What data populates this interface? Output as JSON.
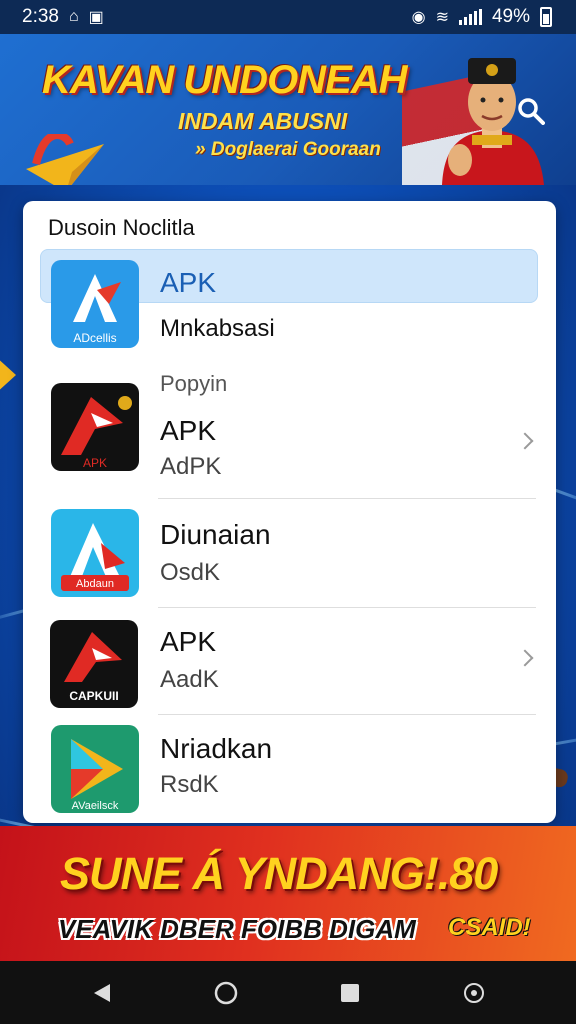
{
  "status_bar": {
    "time": "2:38",
    "battery": "49%"
  },
  "banner": {
    "title": "KAVAN UNDONEAH",
    "subtitle": "INDAM ABUSNI",
    "tagline": "» Doglaerai Gooraan"
  },
  "list": {
    "heading": "Dusoin Noclitla",
    "items": [
      {
        "title": "APK",
        "subtitle": "Mnkabsasi",
        "icon": "apk-app-icon-blue",
        "icon_text": "ADcellis",
        "highlighted": true
      },
      {
        "title": "APK",
        "subtitle": "AdPK",
        "overline": "Popyin",
        "icon": "apk-app-icon-black",
        "icon_text": "APK"
      },
      {
        "title": "Diunaian",
        "subtitle": "OsdK",
        "icon": "apk-app-icon-cyan",
        "icon_text": "Abdaun"
      },
      {
        "title": "APK",
        "subtitle": "AadK",
        "icon": "apk-app-icon-dark",
        "icon_text": "CAPKUII"
      },
      {
        "title": "Nriadkan",
        "subtitle": "RsdK",
        "icon": "play-app-icon-green",
        "icon_text": "AVaeilsck"
      }
    ]
  },
  "promo": {
    "title": "SUNE Á YNDANG!.80",
    "subtitle": "VEAVIK DBER FOIBB DIGAM",
    "badge": "CSAID!"
  },
  "colors": {
    "accent": "#ffd21f",
    "banner_blue": "#1a5bb8",
    "promo_red": "#d0201c",
    "highlight": "#cfe6fb"
  }
}
